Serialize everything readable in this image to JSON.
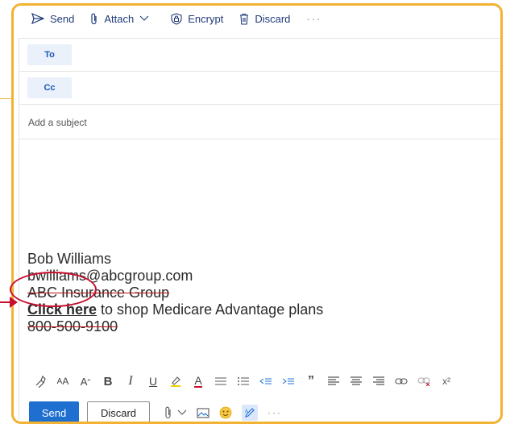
{
  "toolbar": {
    "send": "Send",
    "attach": "Attach",
    "encrypt": "Encrypt",
    "discard": "Discard",
    "more": "···"
  },
  "recipients": {
    "to": "To",
    "cc": "Cc"
  },
  "subject": {
    "placeholder": "Add a subject"
  },
  "signature": {
    "name": "Bob Williams",
    "email": "bwilliams@abcgroup.com",
    "company": "ABC Insurance Group",
    "link_text": "Click here",
    "link_rest": " to shop Medicare Advantage plans",
    "phone": "800-500-9100"
  },
  "format_bar": {
    "superscript": "x²"
  },
  "bottom": {
    "send": "Send",
    "discard": "Discard",
    "more": "···"
  },
  "colors": {
    "frame": "#f2b233",
    "accent": "#1f6fd1",
    "callout": "#c8102e"
  }
}
